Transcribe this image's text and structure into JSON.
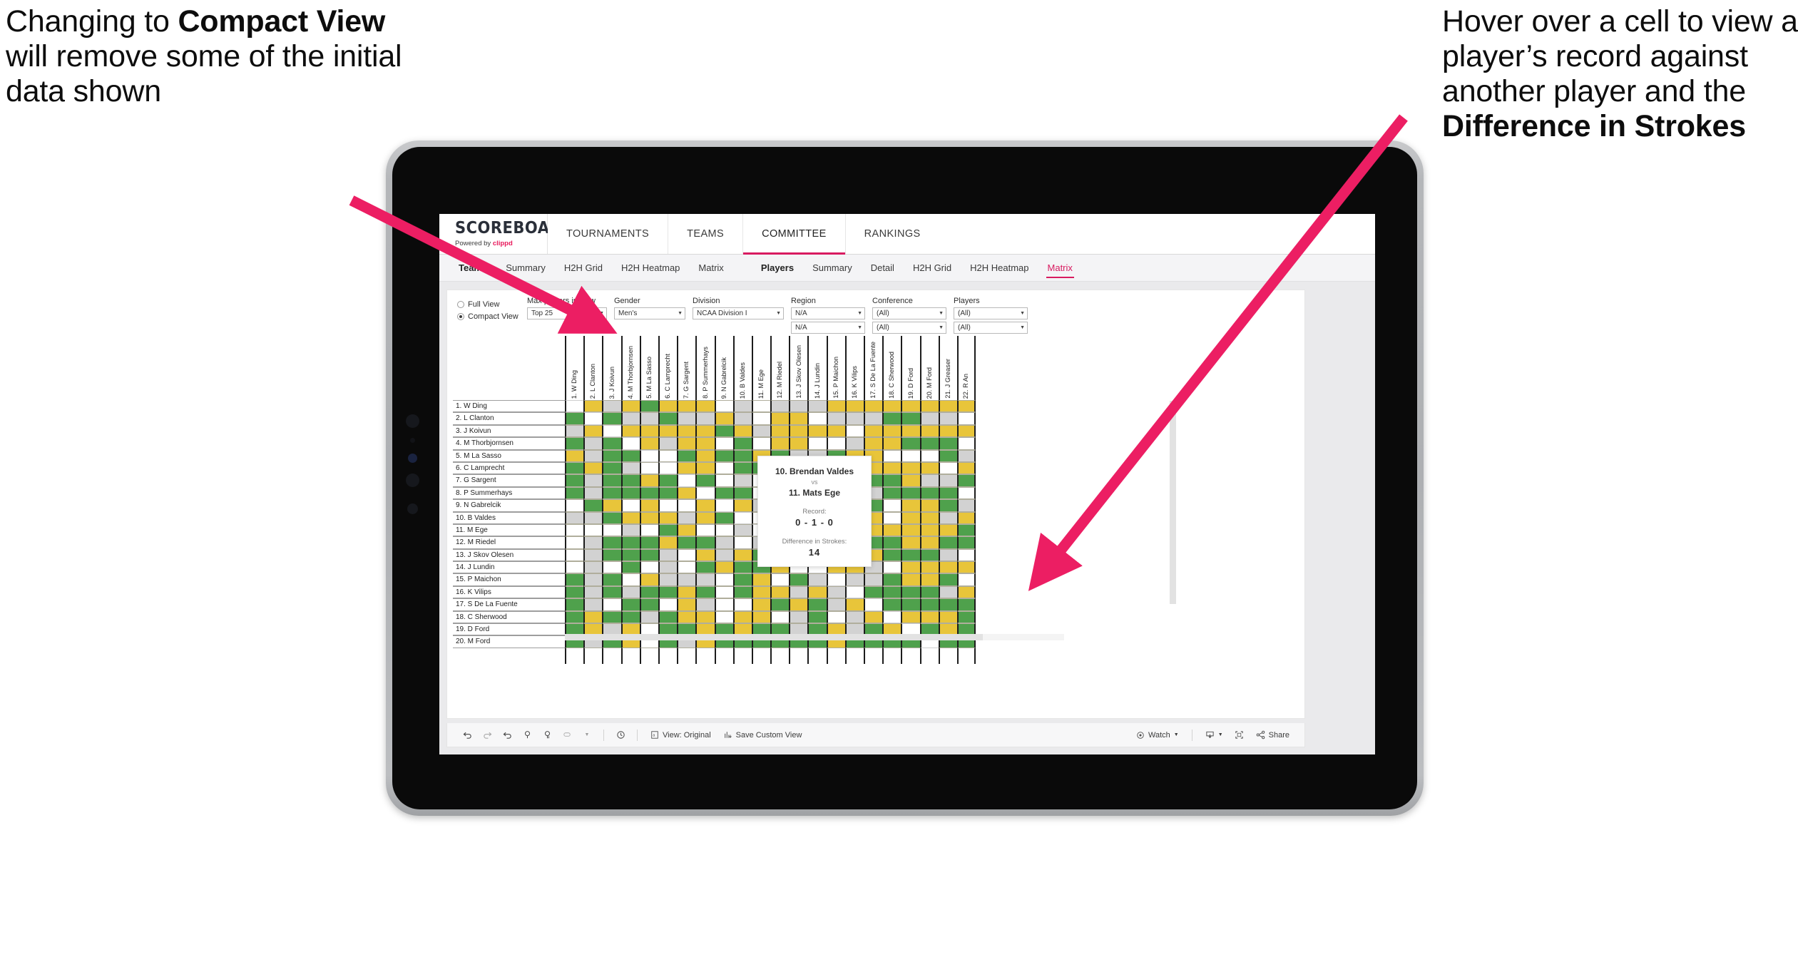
{
  "annotations": {
    "left": {
      "pre": "Changing to ",
      "bold": "Compact View",
      "post": " will remove some of the initial data shown"
    },
    "right": {
      "pre": "Hover over a cell to view a player’s record against another player and the ",
      "bold": "Difference in Strokes",
      "post": ""
    },
    "arrow_color": "#ec1e63"
  },
  "app": {
    "logo": {
      "main": "SCOREBOARD",
      "sub_pre": "Powered by ",
      "sub_brand": "clippd"
    },
    "topnav": [
      {
        "label": "TOURNAMENTS",
        "active": false
      },
      {
        "label": "TEAMS",
        "active": false
      },
      {
        "label": "COMMITTEE",
        "active": true
      },
      {
        "label": "RANKINGS",
        "active": false
      }
    ],
    "subnav_teams": [
      {
        "label": "Teams",
        "head": true,
        "selected": false
      },
      {
        "label": "Summary",
        "head": false,
        "selected": false
      },
      {
        "label": "H2H Grid",
        "head": false,
        "selected": false
      },
      {
        "label": "H2H Heatmap",
        "head": false,
        "selected": false
      },
      {
        "label": "Matrix",
        "head": false,
        "selected": false
      }
    ],
    "subnav_players": [
      {
        "label": "Players",
        "head": true,
        "selected": false
      },
      {
        "label": "Summary",
        "head": false,
        "selected": false
      },
      {
        "label": "Detail",
        "head": false,
        "selected": false
      },
      {
        "label": "H2H Grid",
        "head": false,
        "selected": false
      },
      {
        "label": "H2H Heatmap",
        "head": false,
        "selected": false
      },
      {
        "label": "Matrix",
        "head": false,
        "selected": true
      }
    ]
  },
  "filters": {
    "view_modes": [
      {
        "label": "Full View",
        "selected": false
      },
      {
        "label": "Compact View",
        "selected": true
      }
    ],
    "max_players": {
      "label": "Max players in view",
      "value": "Top 25"
    },
    "gender": {
      "label": "Gender",
      "value": "Men's"
    },
    "division": {
      "label": "Division",
      "value": "NCAA Division I"
    },
    "region": {
      "label": "Region",
      "value1": "N/A",
      "value2": "N/A"
    },
    "conference": {
      "label": "Conference",
      "value1": "(All)",
      "value2": "(All)"
    },
    "players": {
      "label": "Players",
      "value1": "(All)",
      "value2": "(All)"
    }
  },
  "matrix": {
    "columns": [
      "1. W Ding",
      "2. L Clanton",
      "3. J Koivun",
      "4. M Thorbjornsen",
      "5. M La Sasso",
      "6. C Lamprecht",
      "7. G Sargent",
      "8. P Summerhays",
      "9. N Gabrelcik",
      "10. B Valdes",
      "11. M Ege",
      "12. M Riedel",
      "13. J Skov Olesen",
      "14. J Lundin",
      "15. P Maichon",
      "16. K Vilips",
      "17. S De La Fuente",
      "18. C Sherwood",
      "19. D Ford",
      "20. M Ford",
      "21. J Greaser",
      "22. R An"
    ],
    "rows": [
      "1. W Ding",
      "2. L Clanton",
      "3. J Koivun",
      "4. M Thorbjornsen",
      "5. M La Sasso",
      "6. C Lamprecht",
      "7. G Sargent",
      "8. P Summerhays",
      "9. N Gabrelcik",
      "10. B Valdes",
      "11. M Ege",
      "12. M Riedel",
      "13. J Skov Olesen",
      "14. J Lundin",
      "15. P Maichon",
      "16. K Vilips",
      "17. S De La Fuente",
      "18. C Sherwood",
      "19. D Ford",
      "20. M Ford"
    ],
    "legend_colors": {
      "win": "#4fa14c",
      "loss": "#e8c53a",
      "tie": "#d2d2d2",
      "none": "#ffffff"
    },
    "cells": [
      [
        "n",
        "y",
        "a",
        "y",
        "g",
        "y",
        "y",
        "y",
        "w",
        "a",
        "w",
        "a",
        "a",
        "a",
        "y",
        "y",
        "y",
        "y",
        "y",
        "y",
        "y",
        "y"
      ],
      [
        "g",
        "n",
        "g",
        "a",
        "a",
        "g",
        "a",
        "a",
        "y",
        "a",
        "w",
        "y",
        "y",
        "w",
        "a",
        "a",
        "a",
        "g",
        "g",
        "a",
        "a",
        "w"
      ],
      [
        "a",
        "y",
        "n",
        "y",
        "y",
        "y",
        "y",
        "y",
        "g",
        "y",
        "a",
        "y",
        "y",
        "y",
        "y",
        "w",
        "y",
        "y",
        "y",
        "y",
        "y",
        "y"
      ],
      [
        "g",
        "a",
        "g",
        "n",
        "y",
        "a",
        "y",
        "y",
        "w",
        "g",
        "w",
        "y",
        "y",
        "w",
        "w",
        "a",
        "y",
        "y",
        "g",
        "g",
        "g",
        "w"
      ],
      [
        "y",
        "a",
        "g",
        "g",
        "n",
        "w",
        "g",
        "y",
        "g",
        "g",
        "y",
        "g",
        "a",
        "a",
        "g",
        "y",
        "y",
        "w",
        "w",
        "w",
        "g",
        "a"
      ],
      [
        "g",
        "y",
        "g",
        "a",
        "w",
        "n",
        "y",
        "y",
        "w",
        "g",
        "g",
        "y",
        "w",
        "w",
        "a",
        "y",
        "y",
        "y",
        "y",
        "y",
        "w",
        "y"
      ],
      [
        "g",
        "a",
        "g",
        "g",
        "y",
        "g",
        "n",
        "g",
        "w",
        "a",
        "w",
        "y",
        "g",
        "y",
        "a",
        "y",
        "g",
        "g",
        "y",
        "a",
        "a",
        "g"
      ],
      [
        "g",
        "a",
        "g",
        "g",
        "g",
        "g",
        "y",
        "n",
        "g",
        "g",
        "w",
        "y",
        "g",
        "a",
        "a",
        "y",
        "a",
        "g",
        "g",
        "g",
        "g",
        "w"
      ],
      [
        "w",
        "g",
        "y",
        "w",
        "y",
        "w",
        "w",
        "y",
        "n",
        "y",
        "a",
        "w",
        "g",
        "w",
        "a",
        "w",
        "g",
        "w",
        "y",
        "y",
        "g",
        "a"
      ],
      [
        "a",
        "a",
        "g",
        "y",
        "y",
        "y",
        "a",
        "y",
        "g",
        "n",
        "w",
        "y",
        "w",
        "g",
        "w",
        "w",
        "y",
        "w",
        "y",
        "y",
        "a",
        "y"
      ],
      [
        "w",
        "w",
        "w",
        "a",
        "w",
        "g",
        "y",
        "w",
        "w",
        "a",
        "n",
        "y",
        "y",
        "y",
        "y",
        "y",
        "y",
        "y",
        "y",
        "y",
        "y",
        "g"
      ],
      [
        "w",
        "a",
        "g",
        "g",
        "g",
        "y",
        "g",
        "g",
        "a",
        "w",
        "a",
        "n",
        "y",
        "y",
        "a",
        "g",
        "g",
        "g",
        "y",
        "y",
        "g",
        "g"
      ],
      [
        "w",
        "a",
        "g",
        "g",
        "g",
        "a",
        "w",
        "y",
        "a",
        "y",
        "g",
        "y",
        "n",
        "w",
        "y",
        "a",
        "y",
        "g",
        "g",
        "g",
        "a",
        "w"
      ],
      [
        "w",
        "a",
        "w",
        "g",
        "w",
        "a",
        "w",
        "g",
        "y",
        "g",
        "g",
        "y",
        "w",
        "n",
        "y",
        "y",
        "a",
        "w",
        "y",
        "y",
        "y",
        "y"
      ],
      [
        "g",
        "a",
        "g",
        "w",
        "y",
        "a",
        "a",
        "a",
        "w",
        "g",
        "y",
        "w",
        "g",
        "a",
        "n",
        "a",
        "a",
        "g",
        "y",
        "y",
        "g",
        "w"
      ],
      [
        "g",
        "a",
        "g",
        "a",
        "g",
        "g",
        "y",
        "g",
        "w",
        "g",
        "y",
        "y",
        "a",
        "y",
        "a",
        "n",
        "g",
        "g",
        "g",
        "g",
        "a",
        "y"
      ],
      [
        "g",
        "a",
        "w",
        "g",
        "g",
        "w",
        "y",
        "a",
        "w",
        "w",
        "y",
        "g",
        "y",
        "g",
        "a",
        "y",
        "n",
        "g",
        "g",
        "g",
        "g",
        "g"
      ],
      [
        "g",
        "y",
        "g",
        "g",
        "a",
        "g",
        "y",
        "y",
        "w",
        "y",
        "y",
        "w",
        "a",
        "g",
        "w",
        "a",
        "y",
        "n",
        "y",
        "y",
        "y",
        "g"
      ],
      [
        "g",
        "y",
        "a",
        "y",
        "w",
        "g",
        "g",
        "y",
        "g",
        "y",
        "g",
        "g",
        "a",
        "g",
        "y",
        "a",
        "g",
        "y",
        "n",
        "g",
        "y",
        "g"
      ],
      [
        "g",
        "a",
        "g",
        "y",
        "w",
        "g",
        "a",
        "y",
        "g",
        "g",
        "g",
        "g",
        "g",
        "g",
        "y",
        "g",
        "g",
        "g",
        "g",
        "n",
        "g",
        "g"
      ]
    ]
  },
  "tooltip": {
    "player_a": "10. Brendan Valdes",
    "vs": "vs",
    "player_b": "11. Mats Ege",
    "record_label": "Record:",
    "record_value": "0 - 1 - 0",
    "strokes_label": "Difference in Strokes:",
    "strokes_value": "14"
  },
  "toolbar": {
    "icons": [
      "undo-icon",
      "redo-icon",
      "revert-icon",
      "refresh-icon",
      "pause-icon",
      "highlight-icon",
      "dropdown-caret-icon",
      "clock-icon"
    ],
    "view_label": "View: Original",
    "save_label": "Save Custom View",
    "watch_label": "Watch",
    "share_label": "Share"
  }
}
